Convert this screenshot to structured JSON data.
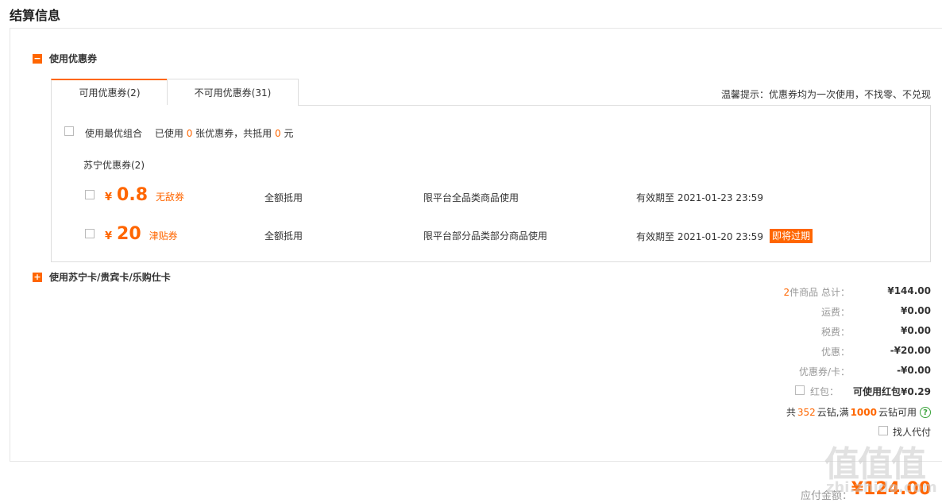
{
  "page_title": "结算信息",
  "coupon_section": {
    "title": "使用优惠券",
    "toggle_symbol": "−",
    "tabs": [
      {
        "label": "可用优惠券(2)"
      },
      {
        "label": "不可用优惠券(31)"
      }
    ],
    "hint": "温馨提示：优惠券均为一次使用，不找零、不兑现",
    "best_combo": {
      "label": "使用最优组合",
      "used_prefix": "已使用",
      "used_count": "0",
      "used_mid": "张优惠券，共抵用",
      "used_amount": "0",
      "used_suffix": "元"
    },
    "group_title": "苏宁优惠券(2)",
    "coupons": [
      {
        "currency": "¥",
        "amount": "0.8",
        "type": "无敌券",
        "usage": "全额抵用",
        "scope": "限平台全品类商品使用",
        "validity": "有效期至 2021-01-23 23:59",
        "badge": ""
      },
      {
        "currency": "¥",
        "amount": "20",
        "type": "津贴券",
        "usage": "全额抵用",
        "scope": "限平台部分品类部分商品使用",
        "validity": "有效期至 2021-01-20 23:59",
        "badge": "即将过期"
      }
    ]
  },
  "card_section": {
    "title": "使用苏宁卡/贵宾卡/乐购仕卡",
    "toggle_symbol": "+"
  },
  "summary": {
    "items_count": "2",
    "items_label": "件商品 总计：",
    "total": "¥144.00",
    "shipping_label": "运费：",
    "shipping": "¥0.00",
    "tax_label": "税费：",
    "tax": "¥0.00",
    "discount_label": "优惠：",
    "discount": "-¥20.00",
    "coupon_card_label": "优惠券/卡：",
    "coupon_card": "-¥0.00",
    "redpacket_label": "红包：",
    "redpacket": "可使用红包¥0.29",
    "diamonds_prefix": "共",
    "diamonds_total": "352",
    "diamonds_mid": "云钻,满",
    "diamonds_min": "1000",
    "diamonds_suffix": "云钻可用",
    "help_symbol": "?",
    "pay_for_me": "找人代付",
    "payable_label": "应付金额：",
    "payable": "¥124.00"
  },
  "watermark": {
    "glyphs": "值值值",
    "site": "zhi.zhido.com"
  },
  "colors": {
    "accent": "#ff6600",
    "help_green": "#3aa33a",
    "border": "#dddddd"
  }
}
